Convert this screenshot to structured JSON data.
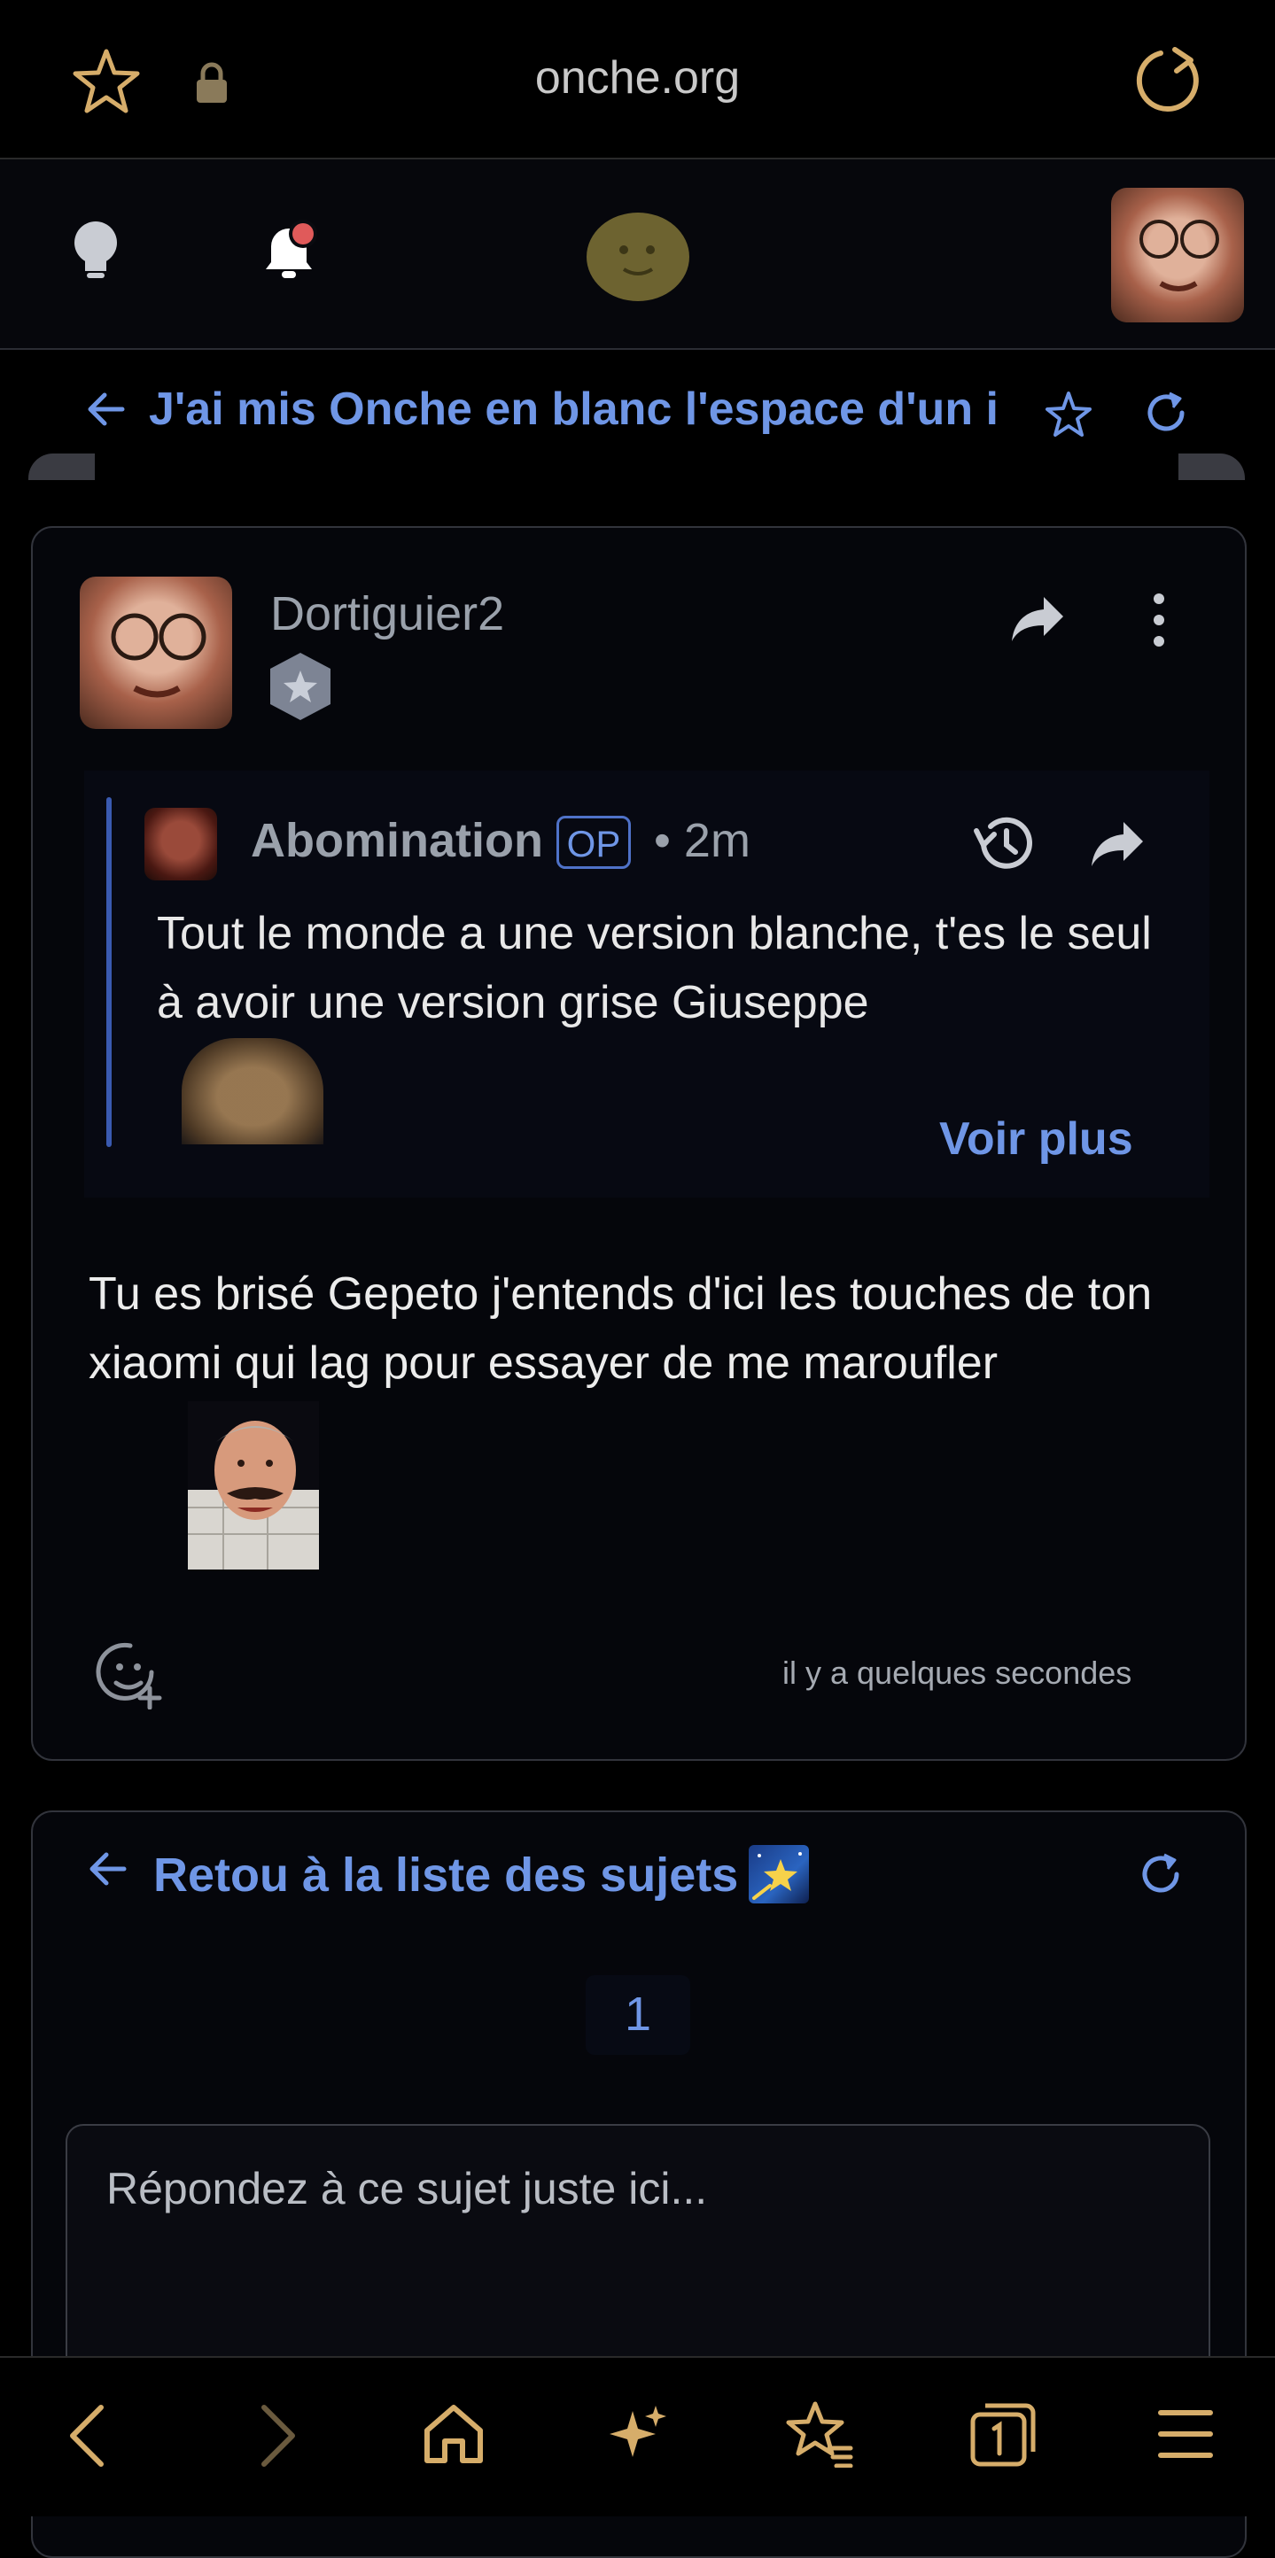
{
  "browser": {
    "url": "onche.org"
  },
  "topic": {
    "title": "J'ai mis Onche en blanc l'espace d'un i"
  },
  "post": {
    "author": "Dortiguier2",
    "quote": {
      "author": "Abomination",
      "op_label": "OP",
      "time": "• 2m",
      "text": "Tout le monde a une version blanche, t'es le seul à avoir une version grise Giuseppe",
      "more_label": "Voir plus"
    },
    "text": "Tu es brisé Gepeto j'entends d'ici les touches de ton xiaomi qui lag pour essayer de me maroufler",
    "timestamp": "il y a quelques secondes"
  },
  "footer": {
    "back_label": "Retou à la liste des sujets",
    "page": "1",
    "reply_placeholder": "Répondez à ce sujet juste ici..."
  },
  "colors": {
    "accent": "#6f96e6",
    "browser_icon": "#d6ad6a",
    "background": "#05060b"
  }
}
